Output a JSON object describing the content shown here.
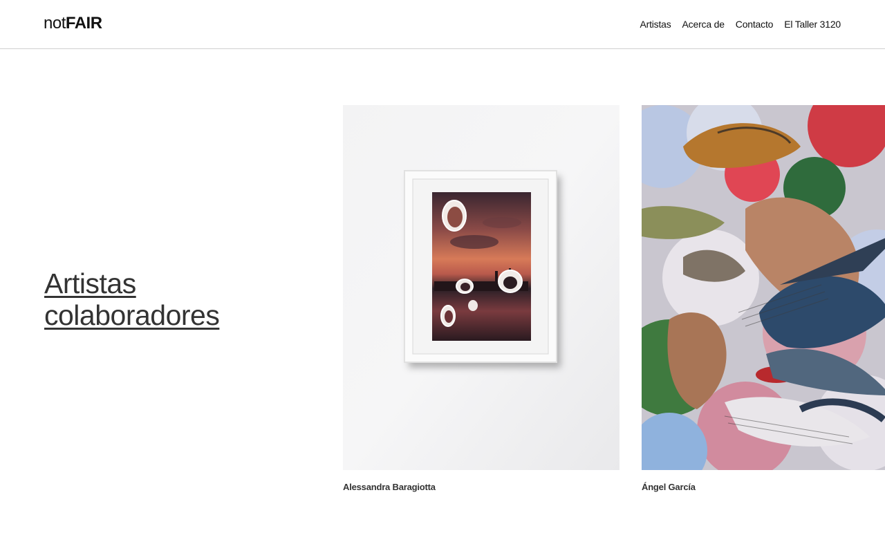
{
  "header": {
    "logo": {
      "light": "not",
      "bold": "FAIR"
    },
    "nav": [
      {
        "label": "Artistas"
      },
      {
        "label": "Acerca de"
      },
      {
        "label": "Contacto"
      },
      {
        "label": "El Taller 3120"
      }
    ]
  },
  "main": {
    "title_line1": "Artistas",
    "title_line2": "colaboradores",
    "artists": [
      {
        "name": "Alessandra Baragiotta"
      },
      {
        "name": "Ángel García"
      }
    ]
  },
  "colors": {
    "border": "#cfcfcf",
    "title": "#333333",
    "text": "#111111"
  }
}
